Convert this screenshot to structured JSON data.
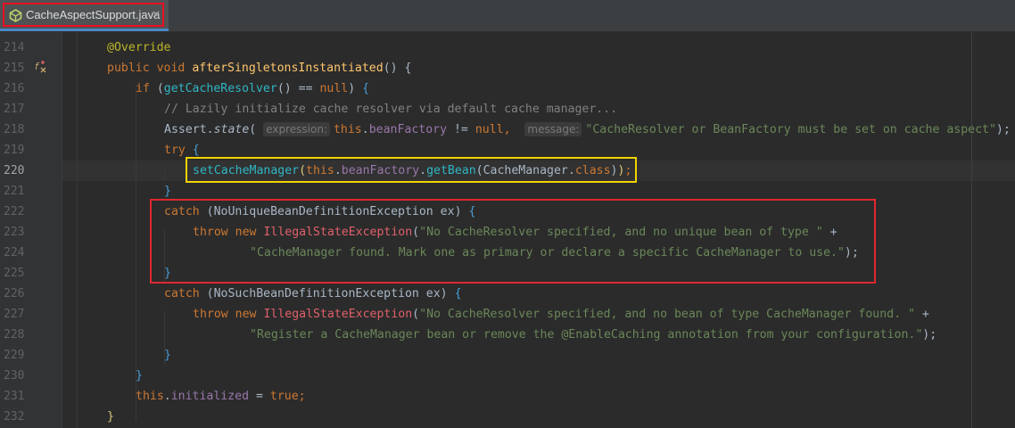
{
  "tab": {
    "filename": "CacheAspectSupport.java",
    "close_glyph": "✕",
    "icon": "java-class-icon"
  },
  "gutter": {
    "override_icon": "override-implements-icon",
    "line_numbers": [
      "214",
      "215",
      "216",
      "217",
      "218",
      "219",
      "220",
      "221",
      "222",
      "223",
      "224",
      "225",
      "226",
      "227",
      "228",
      "229",
      "230",
      "231",
      "232"
    ],
    "current_line": "220"
  },
  "code": {
    "l214": {
      "annotation": "@Override"
    },
    "l215": {
      "kw1": "public",
      "kw2": "void",
      "method": "afterSingletonsInstantiated",
      "rest": "() {"
    },
    "l216": {
      "kw": "if",
      "p1": " (",
      "call": "getCacheResolver",
      "p2": "() == ",
      "null": "null",
      "p3": ") ",
      "brace": "{"
    },
    "l217": {
      "comment": "// Lazily initialize cache resolver via default cache manager..."
    },
    "l218": {
      "cls": "Assert",
      "dot": ".",
      "method": "state",
      "paren": "(",
      "hint1": "expression:",
      "this": "this",
      "dot2": ".",
      "field": "beanFactory",
      "op": " != ",
      "null": "null",
      "comma": ",",
      "hint2": "message:",
      "str": "\"CacheResolver or BeanFactory must be set on cache aspect\"",
      "end": ");"
    },
    "l219": {
      "kw": "try",
      "brace": "{"
    },
    "l220": {
      "call": "setCacheManager",
      "p1": "(",
      "this": "this",
      "dot": ".",
      "field": "beanFactory",
      "dot2": ".",
      "call2": "getBean",
      "p2": "(",
      "cls": "CacheManager",
      "dot3": ".",
      "kwclass": "class",
      "p3": ")",
      "p4": ")",
      "semi": ";"
    },
    "l221": {
      "brace": "}"
    },
    "l222": {
      "kw": "catch",
      "p1": " (",
      "type": "NoUniqueBeanDefinitionException",
      "var": " ex",
      "p2": ") ",
      "brace": "{"
    },
    "l223": {
      "kw1": "throw",
      "kw2": "new",
      "exc": "IllegalStateException",
      "p": "(",
      "str": "\"No CacheResolver specified, and no unique bean of type \"",
      "plus": " +"
    },
    "l224": {
      "str": "\"CacheManager found. Mark one as primary or declare a specific CacheManager to use.\"",
      "end": ");"
    },
    "l225": {
      "brace": "}"
    },
    "l226": {
      "kw": "catch",
      "p1": " (",
      "type": "NoSuchBeanDefinitionException",
      "var": " ex",
      "p2": ") ",
      "brace": "{"
    },
    "l227": {
      "kw1": "throw",
      "kw2": "new",
      "exc": "IllegalStateException",
      "p": "(",
      "str": "\"No CacheResolver specified, and no bean of type CacheManager found. \"",
      "plus": " +"
    },
    "l228": {
      "str": "\"Register a CacheManager bean or remove the @EnableCaching annotation from your configuration.\"",
      "end": ");"
    },
    "l229": {
      "brace": "}"
    },
    "l230": {
      "brace": "}"
    },
    "l231": {
      "this": "this",
      "dot": ".",
      "field": "initialized",
      "op": " = ",
      "kwtrue": "true",
      "semi": ";"
    },
    "l232": {
      "brace": "}"
    }
  },
  "colors": {
    "background": "#2b2b2b",
    "keyword": "#cc7832",
    "string": "#6a8759",
    "method_decl": "#ffc66d",
    "field": "#9876aa",
    "comment": "#808080",
    "annotation": "#bbb529",
    "highlight_yellow": "#f0d300",
    "highlight_red": "#e0282e"
  }
}
